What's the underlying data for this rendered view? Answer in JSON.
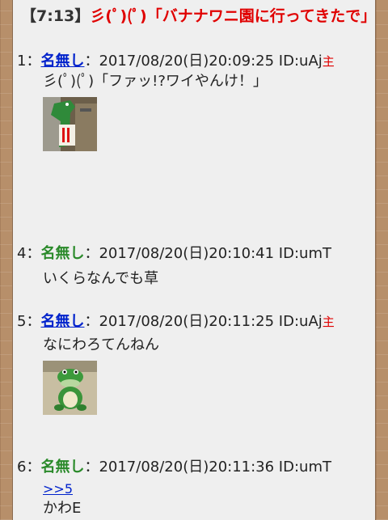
{
  "thread": {
    "time": "【7:13】",
    "title": "彡(ﾟ)(ﾟ)「バナナワニ園に行ってきたで」"
  },
  "posts": [
    {
      "num": "1：",
      "name": "名無し",
      "sep": "：",
      "meta": "2017/08/20(日)20:09:25 ID:uAj",
      "owner": "主",
      "text": "彡(ﾟ)(ﾟ)「ファッ!?ワイやんけ！」"
    },
    {
      "num": "4：",
      "name": "名無し",
      "sep": "：",
      "meta": "2017/08/20(日)20:10:41 ID:umT",
      "text": "いくらなんでも草"
    },
    {
      "num": "5：",
      "name": "名無し",
      "sep": "：",
      "meta": "2017/08/20(日)20:11:25 ID:uAj",
      "owner": "主",
      "text": "なにわろてんねん"
    },
    {
      "num": "6：",
      "name": "名無し",
      "sep": "：",
      "meta": "2017/08/20(日)20:11:36 ID:umT",
      "anchor": ">>5",
      "text": "かわE"
    }
  ],
  "colors": {
    "title_red": "#e00000",
    "link_blue": "#0022cc",
    "name_green": "#2a8a2a"
  }
}
